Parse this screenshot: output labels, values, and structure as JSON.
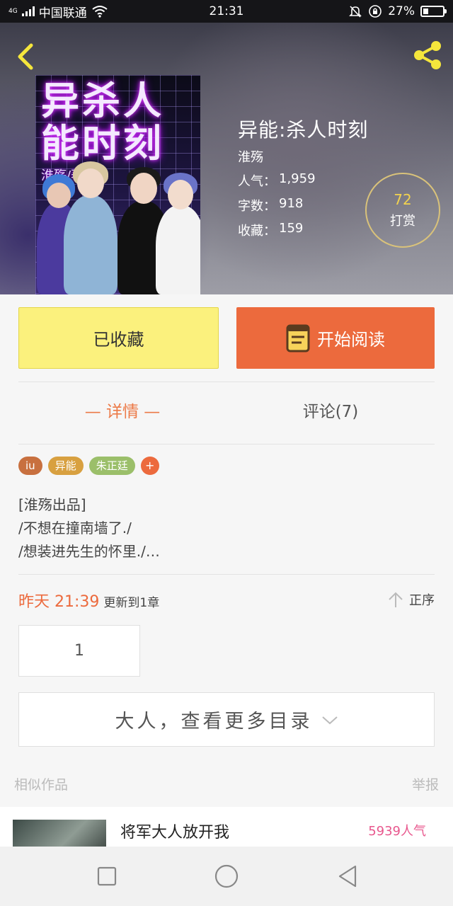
{
  "status_bar": {
    "network": "4G",
    "carrier": "中国联通",
    "time": "21:31",
    "battery": "27%",
    "battery_level": 0.27
  },
  "book": {
    "cover_title": "异杀人能时刻",
    "cover_author": "淮殇/著",
    "title": "异能:杀人时刻",
    "author": "淮殇",
    "popularity_label": "人气：",
    "popularity": "1,959",
    "words_label": "字数：",
    "words": "918",
    "favorites_label": "收藏：",
    "favorites": "159"
  },
  "tip": {
    "count": "72",
    "label": "打赏"
  },
  "actions": {
    "collected": "已收藏",
    "read": "开始阅读"
  },
  "tabs": {
    "details": "— 详情 —",
    "comments": "评论(7)"
  },
  "tags": [
    {
      "label": "iu",
      "color": "#c8703f"
    },
    {
      "label": "异能",
      "color": "#d8a040"
    },
    {
      "label": "朱正廷",
      "color": "#9bbf6a"
    },
    {
      "label": "+",
      "color": "#ec6a3d"
    }
  ],
  "description": [
    "[淮殇出品]",
    "/不想在撞南墙了./",
    "/想装进先生的怀里./…"
  ],
  "update": {
    "when": "昨天 21:39",
    "text": "更新到1章"
  },
  "sort_label": "正序",
  "chapters": [
    "1"
  ],
  "more_catalog": "大人，查看更多目录",
  "similar": {
    "title": "相似作品",
    "report": "举报",
    "items": [
      {
        "name": "将军大人放开我",
        "popularity": "5939人气"
      }
    ]
  },
  "colors": {
    "accent": "#ec6a3d",
    "collected_bg": "#fbf17d",
    "tip_ring": "#d9c27a",
    "share_icon": "#f5e63c"
  }
}
